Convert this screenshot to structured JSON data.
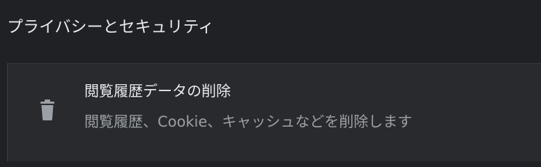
{
  "section": {
    "title": "プライバシーとセキュリティ"
  },
  "clear_browsing_data": {
    "title": "閲覧履歴データの削除",
    "subtitle": "閲覧履歴、Cookie、キャッシュなどを削除します",
    "icon": "trash-icon"
  },
  "colors": {
    "background": "#202124",
    "card": "#292a2d",
    "primary_text": "#e8eaed",
    "secondary_text": "#9aa0a6",
    "icon": "#9aa0a6"
  }
}
